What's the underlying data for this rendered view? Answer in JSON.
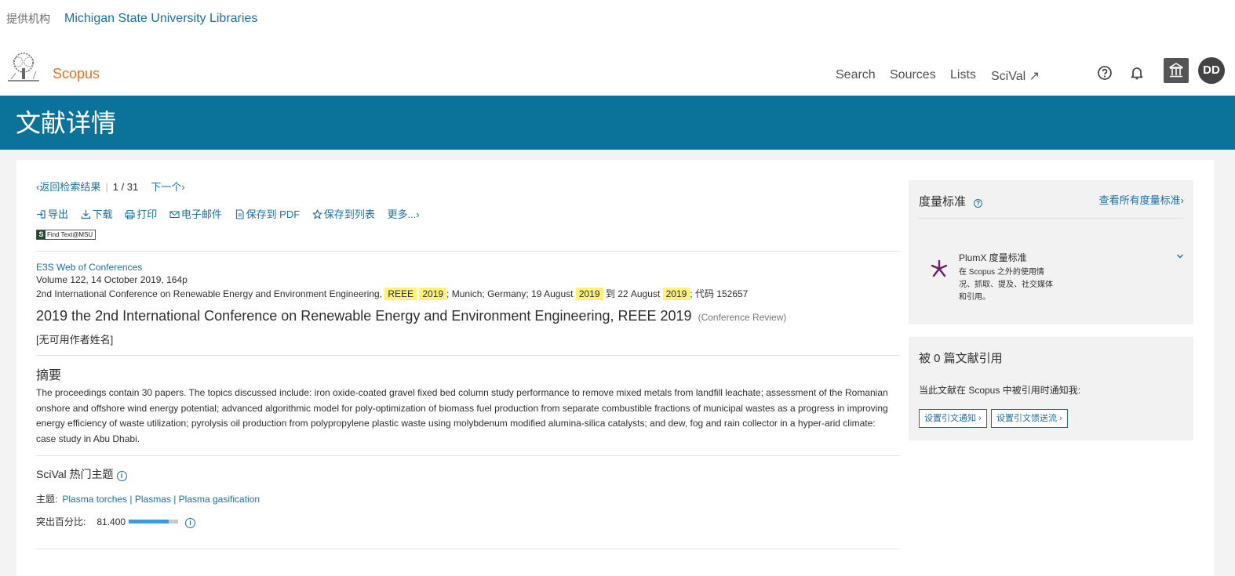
{
  "institution": {
    "label": "提供机构",
    "name": "Michigan State University Libraries"
  },
  "header": {
    "logo_text": "Scopus",
    "nav": [
      "Search",
      "Sources",
      "Lists",
      "SciVal ↗"
    ],
    "avatar_initials": "DD"
  },
  "banner": {
    "title": "文献详情"
  },
  "breadcrumb": {
    "back": "‹返回检索结果",
    "position": "1 / 31",
    "next": "下一个›"
  },
  "actions": [
    "导出",
    "下载",
    "打印",
    "电子邮件",
    "保存到 PDF",
    "保存到列表",
    "更多...›"
  ],
  "findtext": {
    "badge": "S",
    "label": "Find Text@MSU"
  },
  "document": {
    "source": "E3S Web of Conferences",
    "volume": "Volume 122, 14 October 2019, 164p",
    "conf_prefix": "2nd International Conference on Renewable Energy and Environment Engineering,",
    "conf_hl1": "REEE",
    "conf_hl2": "2019",
    "conf_mid1": "; Munich; Germany; 19 August",
    "conf_hl3": "2019",
    "conf_mid2": "到 22 August",
    "conf_hl4": "2019",
    "conf_suffix": "; 代码 152657",
    "title": "2019 the 2nd International Conference on Renewable Energy and Environment Engineering, REEE 2019",
    "type": "(Conference Review)",
    "authors": "[无可用作者姓名]"
  },
  "abstract": {
    "heading": "摘要",
    "text": "The proceedings contain 30 papers. The topics discussed include: iron oxide-coated gravel fixed bed column study performance to remove mixed metals from landfill leachate; assessment of the Romanian onshore and offshore wind energy potential; advanced algorithmic model for poly-optimization of biomass fuel production from separate combustible fractions of municipal wastes as a progress in improving energy efficiency of waste utilization; pyrolysis oil production from polypropylene plastic waste using molybdenum modified alumina-silica catalysts; and dew, fog and rain collector in a hyper-arid climate: case study in Abu Dhabi."
  },
  "scival": {
    "heading": "SciVal 热门主题",
    "topic_label": "主题:",
    "topics": [
      "Plasma torches",
      "Plasmas",
      "Plasma gasification"
    ],
    "prominence_label": "突出百分比:",
    "prominence_value": "81.400",
    "prominence_percentile": 81.4
  },
  "metrics": {
    "title": "度量标准",
    "view_all": "查看所有度量标准›",
    "plumx_title": "PlumX 度量标准",
    "plumx_desc": "在 Scopus 之外的使用情况、抓取、提及、社交媒体和引用。"
  },
  "citations": {
    "title": "被 0 篇文献引用",
    "notify_text": "当此文献在 Scopus 中被引用时通知我:",
    "btn_alert": "设置引文通知 ›",
    "btn_feed": "设置引文馈送流 ›"
  },
  "colors": {
    "banner": "#0b7399",
    "link": "#1d6fa0",
    "logo": "#e9711c",
    "highlight": "#fff27a",
    "plumx": "#6b1f6b"
  }
}
